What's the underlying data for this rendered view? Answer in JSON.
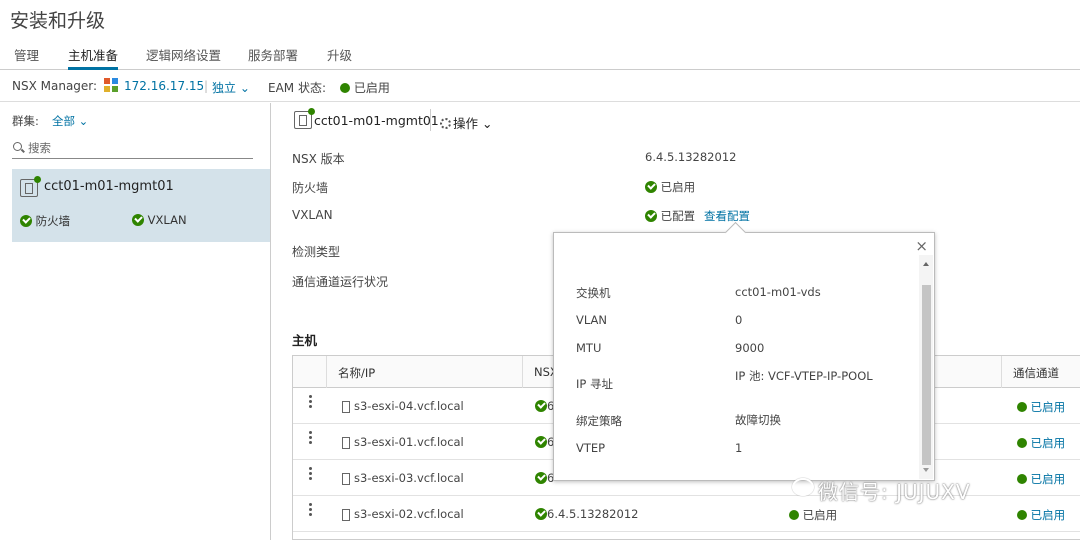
{
  "page": {
    "title": "安装和升级"
  },
  "tabs": [
    {
      "label": "管理"
    },
    {
      "label": "主机准备"
    },
    {
      "label": "逻辑网络设置"
    },
    {
      "label": "服务部署"
    },
    {
      "label": "升级"
    }
  ],
  "manager_bar": {
    "label": "NSX Manager:",
    "ip": "172.16.17.15",
    "separator": "|",
    "mode": "独立",
    "eam_label": "EAM 状态:",
    "eam_status": "已启用",
    "status_color": "#2f8400",
    "accent_color": "#0072a3"
  },
  "left": {
    "cluster_label": "群集:",
    "cluster_filter": "全部",
    "search_placeholder": "搜索",
    "cluster": {
      "name": "cct01-m01-mgmt01",
      "firewall": "防火墙",
      "vxlan": "VXLAN"
    }
  },
  "detail": {
    "title": "cct01-m01-mgmt01",
    "actions_label": "操作",
    "props": [
      {
        "key": "NSX 版本",
        "value": "6.4.5.13282012"
      },
      {
        "key": "防火墙",
        "value": "已启用"
      },
      {
        "key": "VXLAN",
        "value": "已配置",
        "link": "查看配置"
      },
      {
        "key": "检测类型",
        "value": ""
      },
      {
        "key": "通信通道运行状况",
        "value": ""
      }
    ]
  },
  "hosts": {
    "title": "主机",
    "columns": [
      "名称/IP",
      "NSX",
      "通信通道"
    ],
    "rows": [
      {
        "name": "s3-esxi-04.vcf.local",
        "version": "6",
        "firewall": "",
        "channel": "已启用"
      },
      {
        "name": "s3-esxi-01.vcf.local",
        "version": "6",
        "firewall": "",
        "channel": "已启用"
      },
      {
        "name": "s3-esxi-03.vcf.local",
        "version": "6",
        "firewall": "",
        "channel": "已启用"
      },
      {
        "name": "s3-esxi-02.vcf.local",
        "version": "6.4.5.13282012",
        "firewall": "已启用",
        "channel": "已启用"
      }
    ]
  },
  "popover": {
    "close": "×",
    "rows": [
      {
        "key": "交换机",
        "value": "cct01-m01-vds"
      },
      {
        "key": "VLAN",
        "value": "0"
      },
      {
        "key": "MTU",
        "value": "9000"
      },
      {
        "key": "IP 寻址",
        "value": "IP 池: VCF-VTEP-IP-POOL"
      },
      {
        "key": "绑定策略",
        "value": "故障切换"
      },
      {
        "key": "VTEP",
        "value": "1"
      }
    ]
  },
  "watermark": {
    "text": "微信号: JUJUXV"
  }
}
